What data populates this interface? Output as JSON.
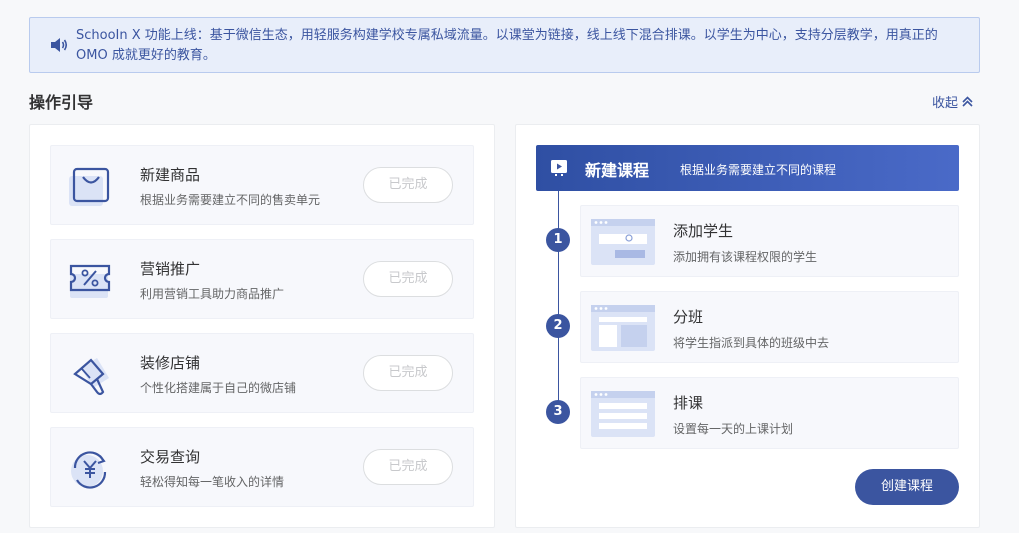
{
  "notice": {
    "text": "SchooIn X 功能上线：基于微信生态，用轻服务构建学校专属私域流量。以课堂为链接，线上线下混合排课。以学生为中心，支持分层教学，用真正的 OMO 成就更好的教育。",
    "icon": "speaker-icon"
  },
  "section": {
    "title": "操作引导",
    "collapse_label": "收起"
  },
  "guides": [
    {
      "title": "新建商品",
      "desc": "根据业务需要建立不同的售卖单元",
      "status": "已完成",
      "icon": "shopping-bag-icon"
    },
    {
      "title": "营销推广",
      "desc": "利用营销工具助力商品推广",
      "status": "已完成",
      "icon": "coupon-icon"
    },
    {
      "title": "装修店铺",
      "desc": "个性化搭建属于自己的微店铺",
      "status": "已完成",
      "icon": "paint-brush-icon"
    },
    {
      "title": "交易查询",
      "desc": "轻松得知每一笔收入的详情",
      "status": "已完成",
      "icon": "yuan-refresh-icon"
    }
  ],
  "course": {
    "title": "新建课程",
    "desc": "根据业务需要建立不同的课程",
    "icon": "play-icon",
    "steps": [
      {
        "num": "1",
        "title": "添加学生",
        "desc": "添加拥有该课程权限的学生"
      },
      {
        "num": "2",
        "title": "分班",
        "desc": "将学生指派到具体的班级中去"
      },
      {
        "num": "3",
        "title": "排课",
        "desc": "设置每一天的上课计划"
      }
    ],
    "create_label": "创建课程"
  },
  "colors": {
    "accent": "#3b55a0",
    "notice_bg": "#e8eefa",
    "card_bg": "#f7f8fc"
  }
}
